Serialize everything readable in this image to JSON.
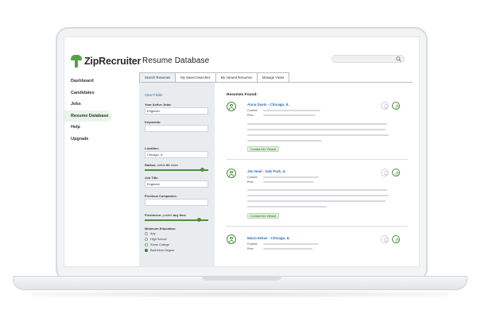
{
  "brand": {
    "name": "ZipRecruiter",
    "accent": "#54a347"
  },
  "sidebar": {
    "items": [
      {
        "label": "Dashboard",
        "active": false
      },
      {
        "label": "Candidates",
        "active": false
      },
      {
        "label": "Jobs",
        "active": false
      },
      {
        "label": "Resume Database",
        "active": true
      },
      {
        "label": "Help",
        "active": false
      },
      {
        "label": "Upgrade",
        "active": false
      }
    ]
  },
  "header": {
    "title": "Resume Database",
    "search_placeholder": ""
  },
  "tabs": [
    {
      "label": "Search Resumes",
      "active": true
    },
    {
      "label": "My Saved Searches",
      "active": false
    },
    {
      "label": "My Viewed Resumes",
      "active": false
    },
    {
      "label": "Manage Views",
      "active": false
    }
  ],
  "filters": {
    "clear_label": "Clear Fields",
    "active_jobs_label": "Your Active Jobs:",
    "active_jobs_value": "Engineer",
    "keywords_label": "Keywords:",
    "keywords_value": "",
    "location_label": "Location:",
    "location_value": "Chicago, IL",
    "radius_label": "Radius:",
    "radius_within": "within",
    "radius_value": "80",
    "radius_unit": "miles",
    "job_title_label": "Job Title:",
    "job_title_value": "Engineer",
    "previous_companies_label": "Previous Companies:",
    "previous_companies_value": "",
    "freshness_label": "Freshness:",
    "freshness_posted": "posted",
    "freshness_value": "any time",
    "education_label": "Minimum Education:",
    "education_options": [
      {
        "label": "Any",
        "selected": false
      },
      {
        "label": "High School",
        "selected": false
      },
      {
        "label": "Some College",
        "selected": false
      },
      {
        "label": "Bachelors Degree",
        "selected": true
      }
    ]
  },
  "results": {
    "title": "Resumes Found:",
    "items": [
      {
        "name": "Anna Davis - Chicago, IL",
        "current_label": "Current:",
        "prev_label": "Prev:",
        "badge": "Contact Info Viewed"
      },
      {
        "name": "Jim Neal - Oak Park, IL",
        "current_label": "Current:",
        "prev_label": "Prev:",
        "badge": "Contact Info Viewed"
      },
      {
        "name": "Maria Edras - Chicago, IL",
        "current_label": "Current:",
        "prev_label": "Prev:",
        "badge": ""
      }
    ]
  }
}
